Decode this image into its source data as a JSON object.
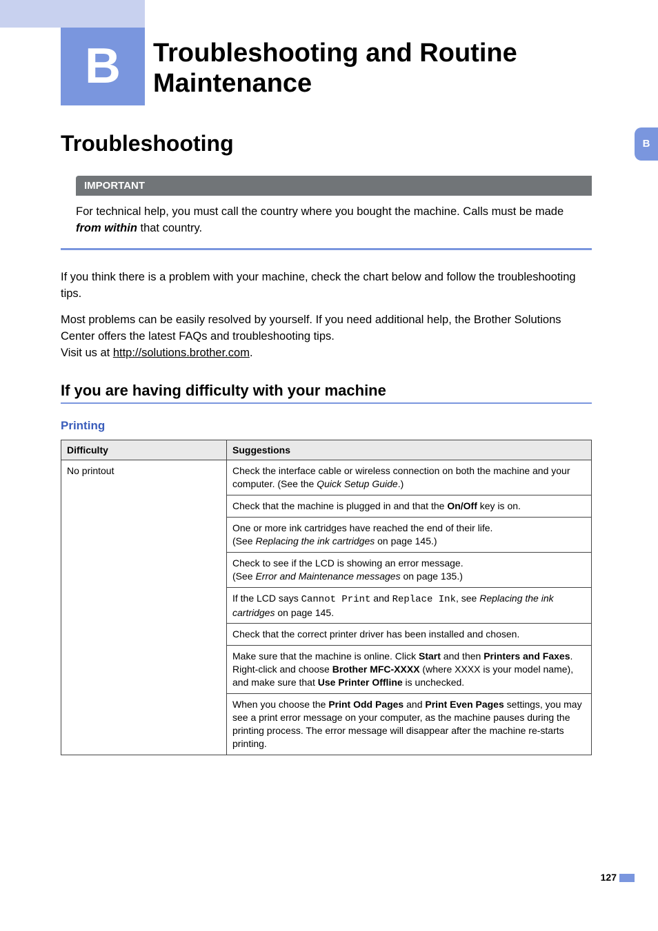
{
  "chapter": {
    "letter": "B",
    "title": "Troubleshooting and Routine Maintenance"
  },
  "side_tab": "B",
  "section_h1": "Troubleshooting",
  "important": {
    "label": "IMPORTANT",
    "text_before": "For technical help, you must call the country where you bought the machine. Calls must be made ",
    "emph": "from within",
    "text_after": " that country."
  },
  "paras": {
    "p1": "If you think there is a problem with your machine, check the chart below and follow the troubleshooting tips.",
    "p2a": "Most problems can be easily resolved by yourself. If you need additional help, the Brother Solutions Center offers the latest FAQs and troubleshooting tips.",
    "p2b_prefix": "Visit us at ",
    "p2b_link": "http://solutions.brother.com",
    "p2b_suffix": "."
  },
  "h2": "If you are having difficulty with your machine",
  "h3": "Printing",
  "table": {
    "headers": {
      "c1": "Difficulty",
      "c2": "Suggestions"
    },
    "difficulty": "No printout",
    "suggestions": {
      "s1a": "Check the interface cable or wireless connection on both the machine and your computer. (See the ",
      "s1b": "Quick Setup Guide",
      "s1c": ".)",
      "s2a": "Check that the machine is plugged in and that the ",
      "s2b": "On/Off",
      "s2c": " key is on.",
      "s3a": "One or more ink cartridges have reached the end of their life.",
      "s3b": "(See ",
      "s3c": "Replacing the ink cartridges",
      "s3d": " on page 145.)",
      "s4a": "Check to see if the LCD is showing an error message.",
      "s4b": "(See ",
      "s4c": "Error and Maintenance messages",
      "s4d": " on page 135.)",
      "s5a": "If the LCD says ",
      "s5b": "Cannot Print",
      "s5c": " and ",
      "s5d": "Replace Ink",
      "s5e": ", see ",
      "s5f": "Replacing the ink cartridges",
      "s5g": " on page 145.",
      "s6": "Check that the correct printer driver has been installed and chosen.",
      "s7a": "Make sure that the machine is online. Click ",
      "s7b": "Start",
      "s7c": " and then ",
      "s7d": "Printers and Faxes",
      "s7e": ". Right-click and choose ",
      "s7f": "Brother MFC-XXXX",
      "s7g": " (where XXXX is your model name), and make sure that ",
      "s7h": "Use Printer Offline",
      "s7i": " is unchecked.",
      "s8a": "When you choose the ",
      "s8b": "Print Odd Pages",
      "s8c": " and ",
      "s8d": "Print Even Pages",
      "s8e": " settings, you may see a print error message on your computer, as the machine pauses during the printing process. The error message will disappear after the machine re-starts printing."
    }
  },
  "page_number": "127"
}
